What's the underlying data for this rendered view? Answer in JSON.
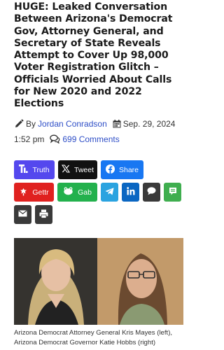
{
  "article": {
    "headline": "HUGE: Leaked Conversation Between Arizona's Democrat Gov, Attorney General, and Secretary of State Reveals Attempt to Cover Up 98,000 Voter Registration Glitch – Officials Worried About Calls for New 2020 and 2022 Elections",
    "by_label": "By",
    "author": "Jordan Conradson",
    "date": "Sep. 29, 2024",
    "time": "1:52 pm",
    "comments": "699 Comments"
  },
  "share": {
    "truth_label": "Truth",
    "twitter_label": "Tweet",
    "facebook_label": "Share",
    "gettr_label": "Gettr",
    "gab_label": "Gab"
  },
  "photo": {
    "caption": "Arizona Democrat Attorney General Kris Mayes (left), Arizona Democrat Governor Katie Hobbs (right)"
  },
  "colors": {
    "link": "#2f4fc7",
    "truth": "#5448ee",
    "twitter": "#111111",
    "facebook": "#1877f2",
    "gettr": "#e0211f",
    "gab": "#23b14d",
    "telegram": "#2aa3e0",
    "linkedin": "#0a66c2",
    "groupme": "#3fae4f",
    "dark_button": "#3a3a3a"
  },
  "icons": [
    "pencil-icon",
    "calendar-icon",
    "comments-icon",
    "truth-icon",
    "x-icon",
    "facebook-icon",
    "gettr-icon",
    "gab-icon",
    "telegram-icon",
    "linkedin-icon",
    "sms-icon",
    "groupme-icon",
    "email-icon",
    "print-icon"
  ]
}
